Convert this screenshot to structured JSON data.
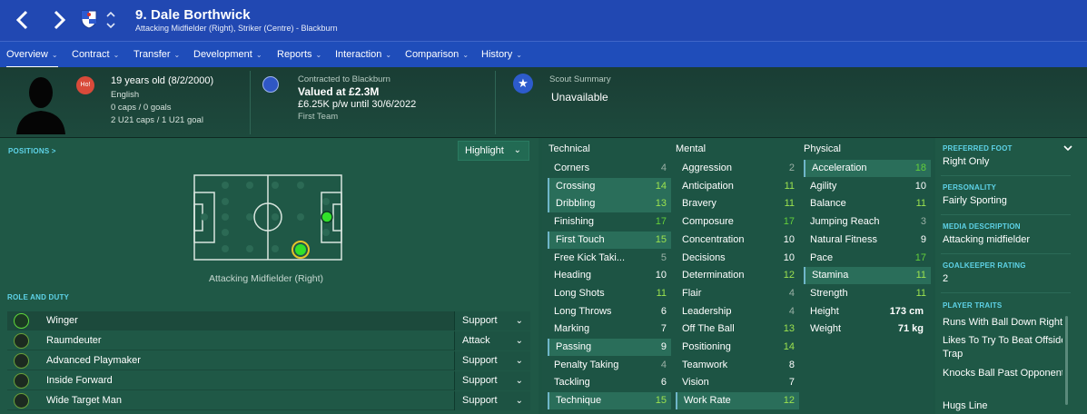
{
  "topbar": {
    "back_icon": "chevron-left-icon",
    "forward_icon": "chevron-right-icon",
    "title": "9. Dale Borthwick",
    "subtitle": "Attacking Midfielder (Right), Striker (Centre) - Blackburn",
    "color": "#2148b2"
  },
  "tabs": [
    {
      "label": "Overview"
    },
    {
      "label": "Contract"
    },
    {
      "label": "Transfer"
    },
    {
      "label": "Development"
    },
    {
      "label": "Reports"
    },
    {
      "label": "Interaction"
    },
    {
      "label": "Comparison"
    },
    {
      "label": "History"
    }
  ],
  "profile": {
    "badge": "Ho!",
    "age": "19 years old (8/2/2000)",
    "nationality": "English",
    "caps": "0 caps / 0 goals",
    "u21": "2 U21 caps / 1 U21 goal"
  },
  "contract": {
    "club_line": "Contracted to Blackburn",
    "value": "Valued at £2.3M",
    "wage": "£6.25K p/w until 30/6/2022",
    "squad": "First Team"
  },
  "scout": {
    "title": "Scout Summary",
    "value": "Unavailable"
  },
  "positions": {
    "link": "POSITIONS >",
    "highlight_label": "Highlight",
    "position_name": "Attacking Midfielder (Right)"
  },
  "roles": {
    "title": "ROLE AND DUTY",
    "items": [
      {
        "name": "Winger",
        "duty": "Support"
      },
      {
        "name": "Raumdeuter",
        "duty": "Attack"
      },
      {
        "name": "Advanced Playmaker",
        "duty": "Support"
      },
      {
        "name": "Inside Forward",
        "duty": "Support"
      },
      {
        "name": "Wide Target Man",
        "duty": "Support"
      }
    ]
  },
  "attributes": {
    "technical": {
      "title": "Technical",
      "items": [
        {
          "name": "Corners",
          "value": "4"
        },
        {
          "name": "Crossing",
          "value": "14"
        },
        {
          "name": "Dribbling",
          "value": "13"
        },
        {
          "name": "Finishing",
          "value": "17"
        },
        {
          "name": "First Touch",
          "value": "15"
        },
        {
          "name": "Free Kick Taki...",
          "value": "5"
        },
        {
          "name": "Heading",
          "value": "10"
        },
        {
          "name": "Long Shots",
          "value": "11"
        },
        {
          "name": "Long Throws",
          "value": "6"
        },
        {
          "name": "Marking",
          "value": "7"
        },
        {
          "name": "Passing",
          "value": "9"
        },
        {
          "name": "Penalty Taking",
          "value": "4"
        },
        {
          "name": "Tackling",
          "value": "6"
        },
        {
          "name": "Technique",
          "value": "15"
        }
      ]
    },
    "mental": {
      "title": "Mental",
      "items": [
        {
          "name": "Aggression",
          "value": "2"
        },
        {
          "name": "Anticipation",
          "value": "11"
        },
        {
          "name": "Bravery",
          "value": "11"
        },
        {
          "name": "Composure",
          "value": "17"
        },
        {
          "name": "Concentration",
          "value": "10"
        },
        {
          "name": "Decisions",
          "value": "10"
        },
        {
          "name": "Determination",
          "value": "12"
        },
        {
          "name": "Flair",
          "value": "4"
        },
        {
          "name": "Leadership",
          "value": "4"
        },
        {
          "name": "Off The Ball",
          "value": "13"
        },
        {
          "name": "Positioning",
          "value": "14"
        },
        {
          "name": "Teamwork",
          "value": "8"
        },
        {
          "name": "Vision",
          "value": "7"
        },
        {
          "name": "Work Rate",
          "value": "12"
        }
      ]
    },
    "physical": {
      "title": "Physical",
      "items": [
        {
          "name": "Acceleration",
          "value": "18"
        },
        {
          "name": "Agility",
          "value": "10"
        },
        {
          "name": "Balance",
          "value": "11"
        },
        {
          "name": "Jumping Reach",
          "value": "3"
        },
        {
          "name": "Natural Fitness",
          "value": "9"
        },
        {
          "name": "Pace",
          "value": "17"
        },
        {
          "name": "Stamina",
          "value": "11"
        },
        {
          "name": "Strength",
          "value": "11"
        }
      ],
      "height_label": "Height",
      "height": "173 cm",
      "weight_label": "Weight",
      "weight": "71 kg"
    }
  },
  "info": {
    "foot_label": "PREFERRED FOOT",
    "foot": "Right Only",
    "personality_label": "PERSONALITY",
    "personality": "Fairly Sporting",
    "media_label": "MEDIA DESCRIPTION",
    "media": "Attacking midfielder",
    "gk_label": "GOALKEEPER RATING",
    "gk": "2",
    "traits_label": "PLAYER TRAITS",
    "traits": [
      "Runs With Ball Down Right",
      "Likes To Try To Beat Offside Trap",
      "Knocks Ball Past Opponent",
      "Hugs Line"
    ]
  },
  "colors": {
    "accent_cyan": "#5ed3e8",
    "good_green": "#9de34f",
    "great_green": "#63cf3a",
    "panel": "#1d5444"
  }
}
